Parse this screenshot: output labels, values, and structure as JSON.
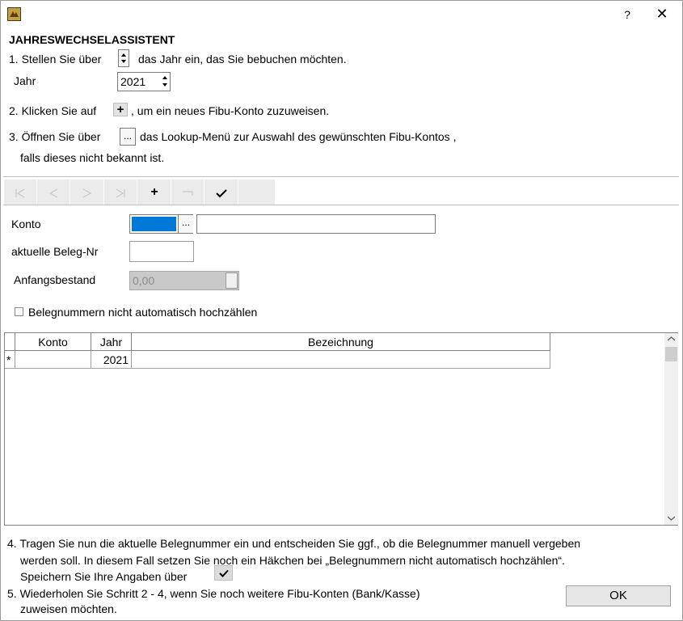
{
  "window": {
    "help": "?",
    "close": "✕"
  },
  "heading": "JAHRESWECHSELASSISTENT",
  "step1": {
    "prefix": "1. Stellen Sie über",
    "suffix": "das Jahr ein, das Sie bebuchen möchten."
  },
  "year": {
    "label": "Jahr",
    "value": "2021"
  },
  "step2": {
    "prefix": "2. Klicken Sie auf",
    "suffix": ", um ein neues Fibu-Konto zuzuweisen."
  },
  "step3": {
    "prefix": "3. Öffnen Sie über",
    "suffix": "das Lookup-Menü zur Auswahl des gewünschten Fibu-Kontos ,",
    "line2": "falls dieses nicht bekannt ist.",
    "dots": "..."
  },
  "form": {
    "konto_label": "Konto",
    "beleg_label": "aktuelle Beleg-Nr",
    "anfang_label": "Anfangsbestand",
    "anfang_value": "0,00",
    "checkbox_label": "Belegnummern nicht automatisch hochzählen",
    "dots": "..."
  },
  "grid": {
    "columns": [
      "Konto",
      "Jahr",
      "Bezeichnung"
    ],
    "rows": [
      {
        "indicator": "*",
        "konto": "",
        "jahr": "2021",
        "bezeichnung": ""
      }
    ]
  },
  "step4": {
    "line1": "4. Tragen Sie nun die aktuelle Belegnummer ein und entscheiden Sie ggf., ob die Belegnummer manuell vergeben",
    "line2": "werden soll. In diesem Fall setzen Sie noch ein Häkchen bei „Belegnummern nicht automatisch hochzählen“.",
    "line3": "Speichern Sie Ihre Angaben über"
  },
  "step5": {
    "line1": "5. Wiederholen Sie Schritt 2 - 4, wenn Sie noch weitere Fibu-Konten (Bank/Kasse)",
    "line2": "zuweisen möchten."
  },
  "ok_label": "OK",
  "colors": {
    "selection": "#0078d7",
    "app_icon": "#c8a040"
  }
}
